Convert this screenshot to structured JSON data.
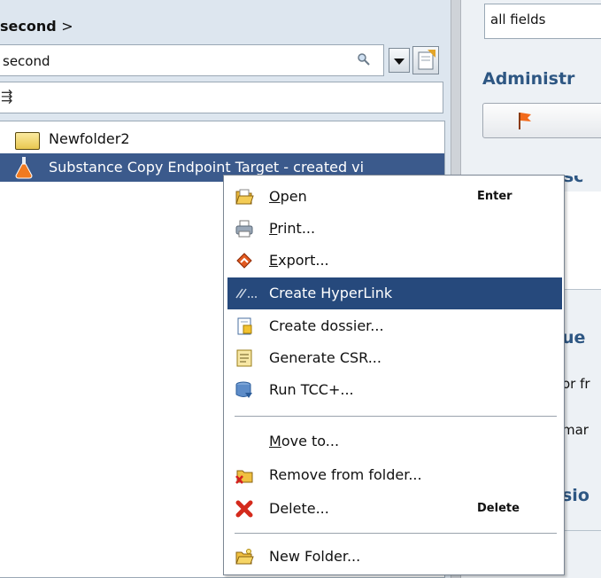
{
  "breadcrumb": {
    "current": "second",
    "separator": ">"
  },
  "search": {
    "value": "second"
  },
  "list": {
    "items": [
      {
        "label": "Newfolder2"
      },
      {
        "label": "Substance Copy Endpoint Target - created vi"
      }
    ]
  },
  "right_panel": {
    "field_value": "all fields",
    "heading_admin": "Administr",
    "heading_short": "Short desc",
    "heading_ue": "ue",
    "text_or_fr": "or fr",
    "text_mar": "mar",
    "heading_sio": "sio"
  },
  "context_menu": {
    "items": [
      {
        "mnemonic": "O",
        "rest": "pen",
        "shortcut": "Enter",
        "icon": "open-folder-icon"
      },
      {
        "mnemonic": "P",
        "rest": "rint...",
        "icon": "printer-icon"
      },
      {
        "mnemonic": "E",
        "rest": "xport...",
        "icon": "export-icon"
      },
      {
        "label": "Create HyperLink",
        "icon": "hyperlink-icon"
      },
      {
        "label": "Create dossier...",
        "icon": "dossier-icon"
      },
      {
        "label": "Generate CSR...",
        "icon": "csr-document-icon"
      },
      {
        "label": "Run TCC+...",
        "icon": "database-icon"
      },
      {
        "mnemonic": "M",
        "rest": "ove to...",
        "icon": ""
      },
      {
        "label": "Remove from folder...",
        "icon": "remove-folder-icon"
      },
      {
        "label": "Delete...",
        "shortcut": "Delete",
        "icon": "delete-x-icon"
      },
      {
        "label": "New Folder...",
        "icon": "new-folder-icon"
      }
    ]
  },
  "colors": {
    "selection": "#3b5a8c",
    "menu_highlight": "#26497c",
    "heading": "#2e5783"
  }
}
